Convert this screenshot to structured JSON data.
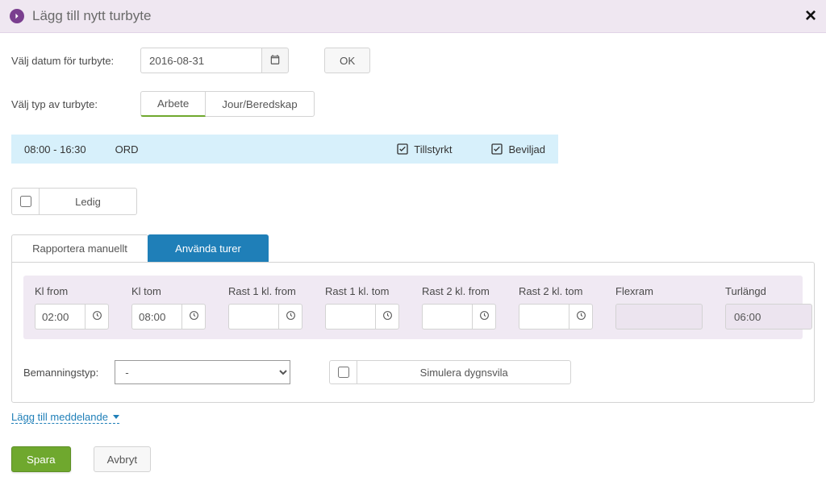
{
  "header": {
    "title": "Lägg till nytt turbyte",
    "icon": "chevron-right-circle-icon",
    "close_label": "×"
  },
  "date_row": {
    "label": "Välj datum för turbyte:",
    "value": "2016-08-31",
    "ok_label": "OK"
  },
  "type_row": {
    "label": "Välj typ av turbyte:",
    "options": {
      "arbete": "Arbete",
      "jour": "Jour/Beredskap"
    },
    "selected": "arbete"
  },
  "shift": {
    "time": "08:00 - 16:30",
    "code": "ORD",
    "flags": {
      "tillstyrkt": "Tillstyrkt",
      "beviljad": "Beviljad"
    }
  },
  "ledig": {
    "label": "Ledig",
    "checked": false
  },
  "tabs": {
    "manual": "Rapportera manuellt",
    "use_shifts": "Använda turer",
    "active": "use_shifts"
  },
  "time_grid": {
    "kl_from": {
      "label": "Kl from",
      "value": "02:00"
    },
    "kl_tom": {
      "label": "Kl tom",
      "value": "08:00"
    },
    "rast1_from": {
      "label": "Rast 1 kl. from",
      "value": ""
    },
    "rast1_tom": {
      "label": "Rast 1 kl. tom",
      "value": ""
    },
    "rast2_from": {
      "label": "Rast 2 kl. from",
      "value": ""
    },
    "rast2_tom": {
      "label": "Rast 2 kl. tom",
      "value": ""
    },
    "flexram": {
      "label": "Flexram",
      "value": ""
    },
    "turlangd": {
      "label": "Turlängd",
      "value": "06:00"
    }
  },
  "staffing": {
    "label": "Bemanningstyp:",
    "selected": "-",
    "options": [
      "-"
    ]
  },
  "simulate": {
    "label": "Simulera dygnsvila",
    "checked": false
  },
  "add_message": {
    "label": "Lägg till meddelande"
  },
  "footer": {
    "save": "Spara",
    "cancel": "Avbryt"
  }
}
